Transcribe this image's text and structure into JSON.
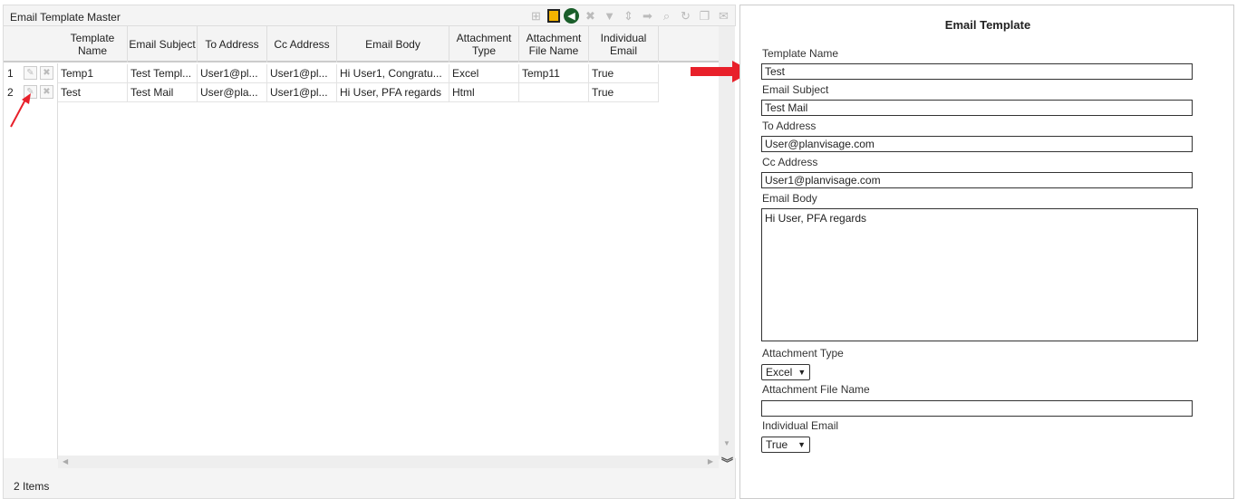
{
  "grid": {
    "title": "Email Template Master",
    "toolbar": [
      "add-icon",
      "save-icon",
      "back-icon",
      "delete-icon",
      "filter-icon",
      "sort-icon",
      "export-icon",
      "search-icon",
      "refresh-icon",
      "copy-icon",
      "mail-icon"
    ],
    "columns": [
      "Template Name",
      "Email Subject",
      "To Address",
      "Cc Address",
      "Email Body",
      "Attachment Type",
      "Attachment File Name",
      "Individual Email"
    ],
    "rows": [
      {
        "num": "1",
        "cells": [
          "Temp1",
          "Test Templ...",
          "User1@pl...",
          "User1@pl...",
          "Hi User1, Congratu...",
          "Excel",
          "Temp11",
          "True"
        ]
      },
      {
        "num": "2",
        "cells": [
          "Test",
          "Test Mail",
          "User@pla...",
          "User1@pl...",
          "Hi User, PFA regards",
          "Html",
          "",
          "True"
        ]
      }
    ],
    "footer": "2 Items"
  },
  "form": {
    "title": "Email Template",
    "template_name_label": "Template Name",
    "template_name": "Test",
    "subject_label": "Email Subject",
    "subject": "Test Mail",
    "to_label": "To Address",
    "to": "User@planvisage.com",
    "cc_label": "Cc Address",
    "cc": "User1@planvisage.com",
    "body_label": "Email Body",
    "body": "Hi User, PFA regards",
    "attachment_type_label": "Attachment Type",
    "attachment_type": "Excel",
    "attachment_file_label": "Attachment File Name",
    "attachment_file": "",
    "individual_label": "Individual Email",
    "individual": "True"
  },
  "colors": {
    "annotation_arrow": "#e8202a"
  }
}
